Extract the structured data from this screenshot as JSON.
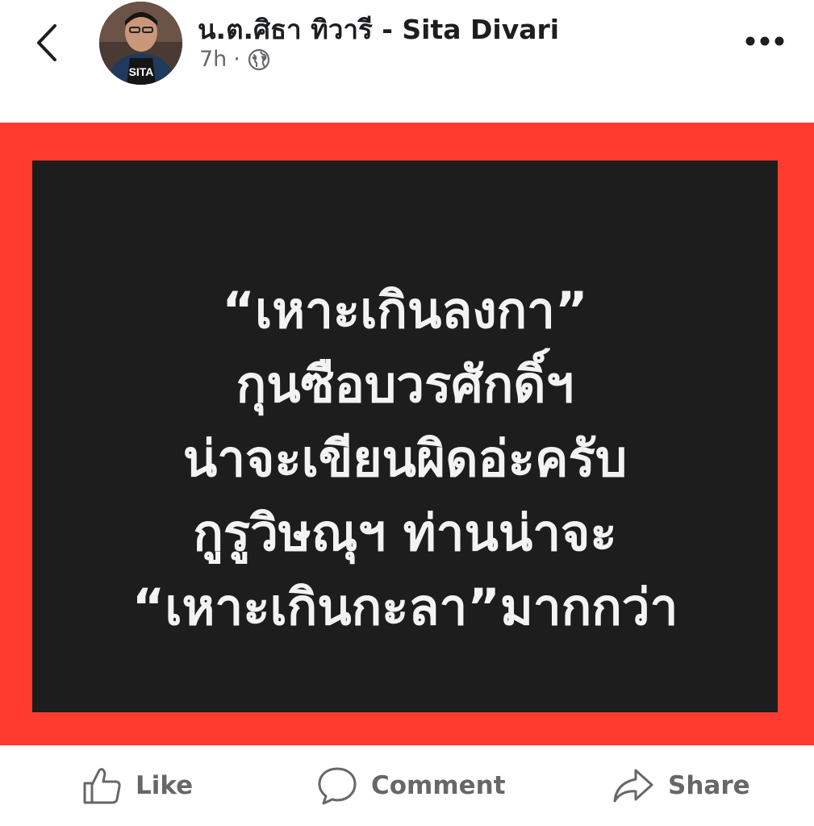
{
  "header": {
    "author_name": "น.ต.ศิธา ทิวารี - Sita Divari",
    "time": "7h",
    "separator": "·",
    "back_icon": "chevron-left-icon",
    "privacy_icon": "globe-icon",
    "more_icon": "more-horizontal-icon"
  },
  "post": {
    "frame_color": "#ff3b30",
    "panel_color": "#1d1d1d",
    "lines": [
      "“เหาะเกินลงกา”",
      "กุนซือบวรศักดิ์ฯ",
      "น่าจะเขียนผิดอ่ะครับ",
      "กูรูวิษณุฯ ท่านน่าจะ",
      "“เหาะเกินกะลา”มากกว่า"
    ]
  },
  "actions": {
    "like_label": "Like",
    "comment_label": "Comment",
    "share_label": "Share"
  }
}
